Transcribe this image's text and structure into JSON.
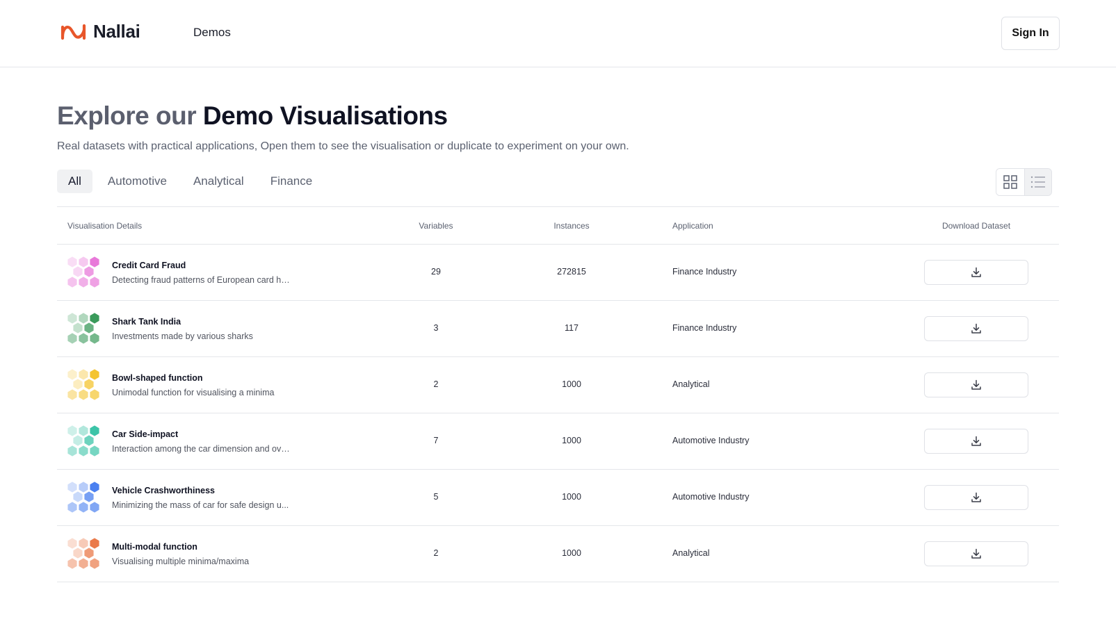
{
  "header": {
    "brand": "Nallai",
    "nav_demos": "Demos",
    "signin_label": "Sign In",
    "logo_color": "#e8562a"
  },
  "hero": {
    "title_light": "Explore our",
    "title_dark": "Demo Visualisations",
    "subtitle": "Real datasets with practical applications, Open them to see the visualisation or duplicate to experiment on your own."
  },
  "filters": [
    "All",
    "Automotive",
    "Analytical",
    "Finance"
  ],
  "active_filter": "All",
  "view_toggle": {
    "grid_icon": "grid-icon",
    "list_icon": "list-icon",
    "active": "list"
  },
  "table": {
    "headers": {
      "details": "Visualisation Details",
      "variables": "Variables",
      "instances": "Instances",
      "application": "Application",
      "download": "Download Dataset"
    },
    "rows": [
      {
        "name": "Credit Card Fraud",
        "desc": "Detecting fraud patterns of European card ho...",
        "variables": "29",
        "instances": "272815",
        "application": "Finance Industry",
        "color": "#e879d9"
      },
      {
        "name": "Shark Tank India",
        "desc": "Investments made by various sharks",
        "variables": "3",
        "instances": "117",
        "application": "Finance Industry",
        "color": "#3a9a5b"
      },
      {
        "name": "Bowl-shaped function",
        "desc": "Unimodal function for visualising a minima",
        "variables": "2",
        "instances": "1000",
        "application": "Analytical",
        "color": "#f4c430"
      },
      {
        "name": "Car Side-impact",
        "desc": "Interaction among the car dimension and over...",
        "variables": "7",
        "instances": "1000",
        "application": "Automotive Industry",
        "color": "#3cc4a8"
      },
      {
        "name": "Vehicle Crashworthiness",
        "desc": "Minimizing the mass of car for safe design u...",
        "variables": "5",
        "instances": "1000",
        "application": "Automotive Industry",
        "color": "#4a80f0"
      },
      {
        "name": "Multi-modal function",
        "desc": "Visualising multiple minima/maxima",
        "variables": "2",
        "instances": "1000",
        "application": "Analytical",
        "color": "#ea7a4a"
      }
    ]
  }
}
